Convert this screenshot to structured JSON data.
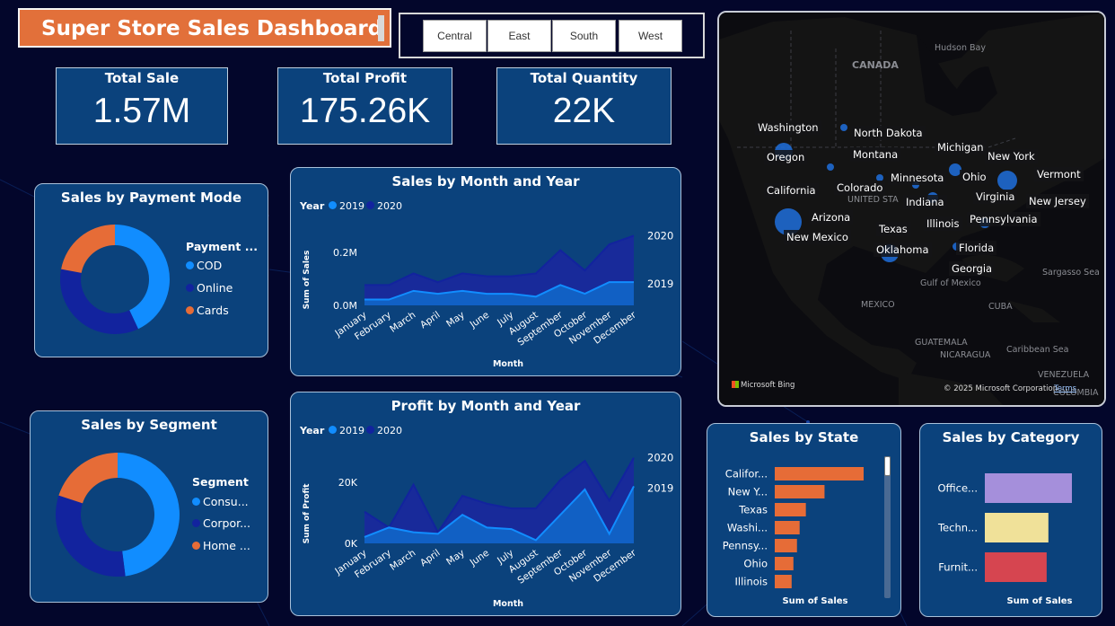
{
  "header": {
    "title": "Super Store Sales Dashboard"
  },
  "slicer": {
    "regions": [
      "Central",
      "East",
      "South",
      "West"
    ]
  },
  "kpis": [
    {
      "label": "Total Sale",
      "value": "1.57M"
    },
    {
      "label": "Total Profit",
      "value": "175.26K"
    },
    {
      "label": "Total Quantity",
      "value": "22K"
    }
  ],
  "payment": {
    "title": "Sales by Payment Mode",
    "legend_title": "Payment ...",
    "items": [
      {
        "label": "COD",
        "color": "#118dff",
        "share": 0.43
      },
      {
        "label": "Online",
        "color": "#12239e",
        "share": 0.35
      },
      {
        "label": "Cards",
        "color": "#e66c37",
        "share": 0.22
      }
    ]
  },
  "segment": {
    "title": "Sales by Segment",
    "legend_title": "Segment",
    "items": [
      {
        "label": "Consu...",
        "color": "#118dff",
        "share": 0.48
      },
      {
        "label": "Corpor...",
        "color": "#12239e",
        "share": 0.32
      },
      {
        "label": "Home ...",
        "color": "#e66c37",
        "share": 0.2
      }
    ]
  },
  "sales_chart": {
    "title": "Sales by Month and Year",
    "legend_label": "Year",
    "xlabel": "Month",
    "ylabel": "Sum of Sales",
    "yticks": [
      "0.2M",
      "0.0M"
    ],
    "end_labels": [
      "2020",
      "2019"
    ]
  },
  "profit_chart": {
    "title": "Profit by Month and Year",
    "legend_label": "Year",
    "xlabel": "Month",
    "ylabel": "Sum of Profit",
    "yticks": [
      "20K",
      "0K"
    ],
    "end_labels": [
      "2020",
      "2019"
    ]
  },
  "state_chart": {
    "title": "Sales by State",
    "xlabel": "Sum of Sales"
  },
  "category_chart": {
    "title": "Sales by Category",
    "xlabel": "Sum of Sales"
  },
  "map": {
    "labels": [
      "Washington",
      "North Dakota",
      "Montana",
      "Michigan",
      "Oregon",
      "New York",
      "Minnesota",
      "Ohio",
      "Vermont",
      "California",
      "Colorado",
      "Virginia",
      "Indiana",
      "New Jersey",
      "Arizona",
      "Illinois",
      "Pennsylvania",
      "Texas",
      "New Mexico",
      "Florida",
      "Oklahoma",
      "Georgia"
    ],
    "geo_labels": [
      "Hudson Bay",
      "CANADA",
      "UNITED STA",
      "Gulf of Mexico",
      "MEXICO",
      "CUBA",
      "Sargasso Sea",
      "GUATEMALA",
      "NICARAGUA",
      "Caribbean Sea",
      "VENEZUELA",
      "COLOMBIA"
    ],
    "bing": "Microsoft Bing",
    "copyright": "© 2025 Microsoft Corporation",
    "terms": "Terms"
  },
  "chart_data": [
    {
      "type": "pie",
      "title": "Sales by Payment Mode",
      "categories": [
        "COD",
        "Online",
        "Cards"
      ],
      "values": [
        0.43,
        0.35,
        0.22
      ]
    },
    {
      "type": "pie",
      "title": "Sales by Segment",
      "categories": [
        "Consu...",
        "Corpor...",
        "Home ..."
      ],
      "values": [
        0.48,
        0.32,
        0.2
      ]
    },
    {
      "type": "area",
      "title": "Sales by Month and Year",
      "xlabel": "Month",
      "ylabel": "Sum of Sales",
      "categories": [
        "January",
        "February",
        "March",
        "April",
        "May",
        "June",
        "July",
        "August",
        "September",
        "October",
        "November",
        "December"
      ],
      "series": [
        {
          "name": "2019",
          "color": "#118dff",
          "values": [
            0.02,
            0.02,
            0.05,
            0.04,
            0.05,
            0.04,
            0.04,
            0.03,
            0.07,
            0.04,
            0.08,
            0.08
          ]
        },
        {
          "name": "2020",
          "color": "#12239e",
          "values": [
            0.07,
            0.07,
            0.11,
            0.08,
            0.11,
            0.1,
            0.1,
            0.11,
            0.19,
            0.12,
            0.21,
            0.24
          ]
        }
      ],
      "ylim": [
        0,
        0.3
      ],
      "legend": "top-left"
    },
    {
      "type": "area",
      "title": "Profit by Month and Year",
      "xlabel": "Month",
      "ylabel": "Sum of Profit",
      "categories": [
        "January",
        "February",
        "March",
        "April",
        "May",
        "June",
        "July",
        "August",
        "September",
        "October",
        "November",
        "December"
      ],
      "series": [
        {
          "name": "2019",
          "color": "#118dff",
          "values": [
            2000,
            5000,
            3500,
            3000,
            9000,
            5000,
            4500,
            1000,
            9000,
            17000,
            3000,
            18000
          ]
        },
        {
          "name": "2020",
          "color": "#12239e",
          "values": [
            10000,
            5000,
            18500,
            3500,
            15000,
            12500,
            11000,
            11000,
            20000,
            26000,
            13500,
            27000
          ]
        }
      ],
      "ylim": [
        0,
        30000
      ],
      "legend": "top-left"
    },
    {
      "type": "bar",
      "title": "Sales by State",
      "xlabel": "Sum of Sales",
      "categories": [
        "Califor...",
        "New Y...",
        "Texas",
        "Washi...",
        "Pennsy...",
        "Ohio",
        "Illinois"
      ],
      "values": [
        100,
        56,
        35,
        28,
        25,
        21,
        19
      ],
      "colors": [
        "#e66c37"
      ]
    },
    {
      "type": "bar",
      "title": "Sales by Category",
      "xlabel": "Sum of Sales",
      "categories": [
        "Office...",
        "Techn...",
        "Furnit..."
      ],
      "values": [
        100,
        73,
        71
      ],
      "colors": [
        "#a58fdb",
        "#f0e199",
        "#d64550"
      ]
    }
  ]
}
